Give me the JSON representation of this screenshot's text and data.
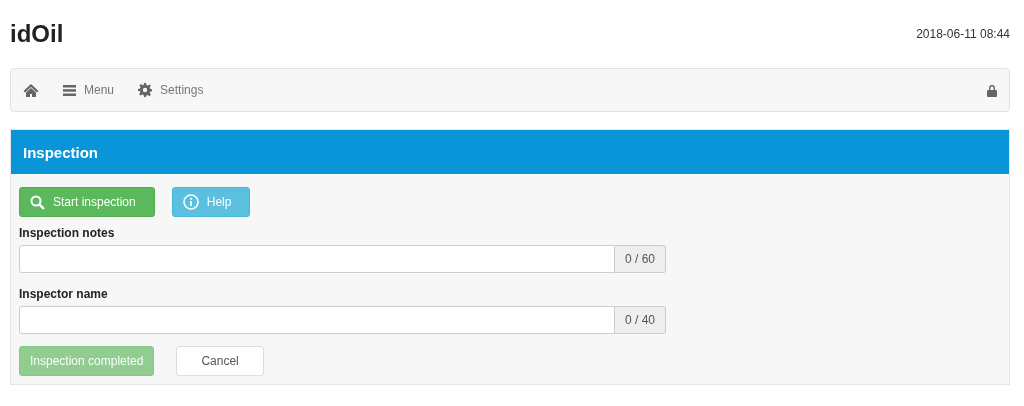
{
  "app_title": "idOil",
  "datetime": "2018-06-11 08:44",
  "navbar": {
    "items": [
      {
        "kind": "home"
      },
      {
        "kind": "menu",
        "label": "Menu"
      },
      {
        "kind": "settings",
        "label": "Settings"
      }
    ],
    "locked": true
  },
  "panel": {
    "title": "Inspection",
    "actions": [
      {
        "kind": "success",
        "label": "Start inspection"
      },
      {
        "kind": "info",
        "label": "Help"
      }
    ],
    "fields": [
      {
        "label": "Inspection notes",
        "counter": "0 / 60"
      },
      {
        "label": "Inspector name",
        "counter": "0 / 40"
      }
    ],
    "buttons": [
      {
        "kind": "success",
        "label": "Inspection completed",
        "disabled": true
      },
      {
        "kind": "default",
        "label": "Cancel",
        "disabled": false
      }
    ]
  }
}
